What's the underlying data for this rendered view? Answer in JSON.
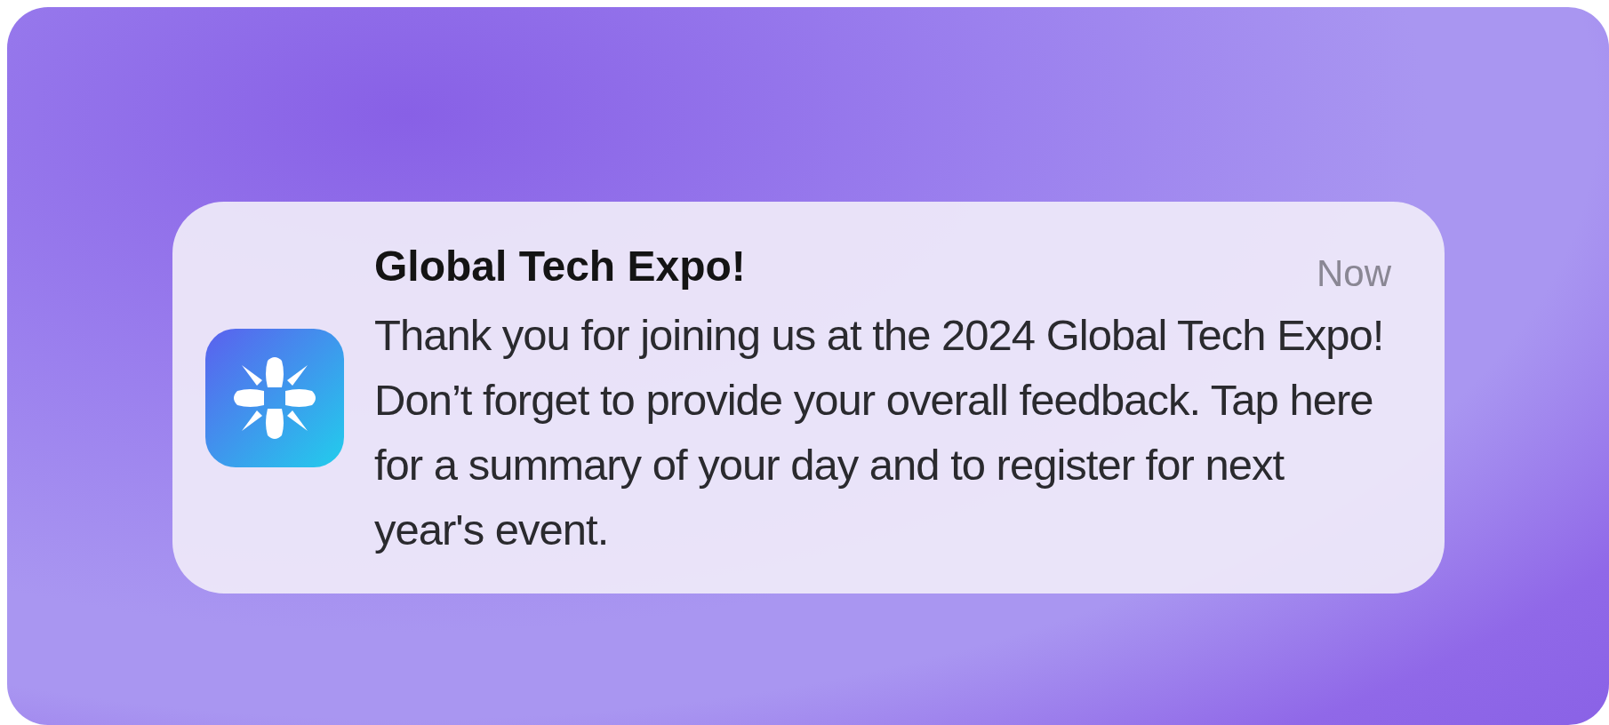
{
  "notification": {
    "title": "Global Tech Expo!",
    "time": "Now",
    "message": "Thank you for joining us at the 2024 Global Tech Expo! Don’t forget to provide your overall feedback. Tap here for a summary of your day and to register for next year's event."
  }
}
